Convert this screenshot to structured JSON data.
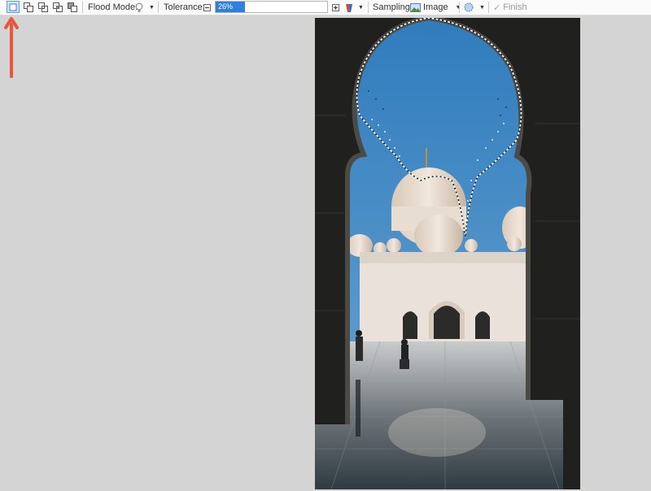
{
  "toolbar": {
    "selection_modes": [
      "replace-icon",
      "union-icon",
      "exclude-icon",
      "intersect-icon",
      "invert-icon"
    ],
    "flood_mode_label": "Flood Mode:",
    "tolerance_label": "Tolerance:",
    "tolerance_value": "26%",
    "tolerance_fraction": 0.26,
    "sampling_label": "Sampling:",
    "sampling_value": "Image",
    "finish_label": "Finish"
  },
  "colors": {
    "accent": "#2f7fde",
    "annotation_arrow": "#e8563c",
    "canvas_background": "#d4d4d4"
  }
}
